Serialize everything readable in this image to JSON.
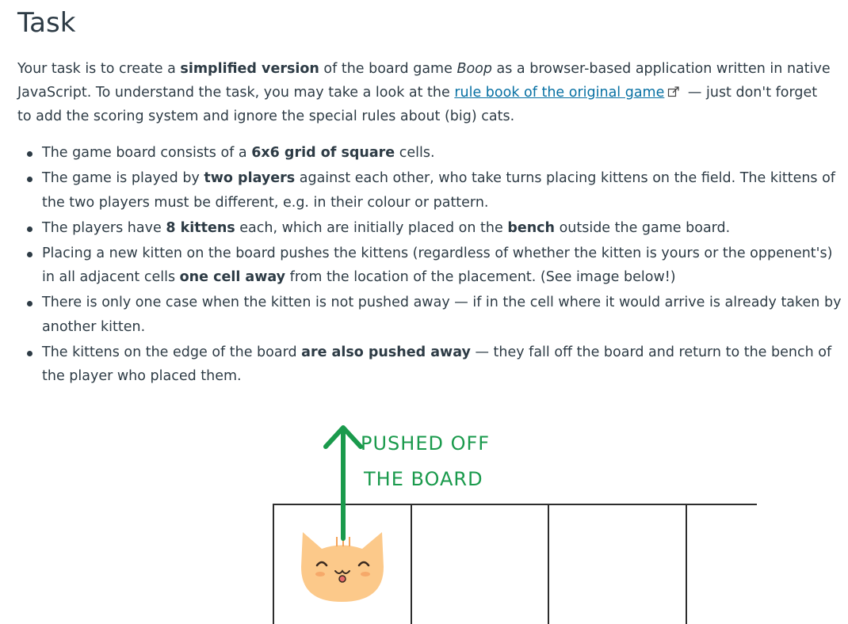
{
  "title": "Task",
  "intro": {
    "t1": "Your task is to create a ",
    "b1": "simplified version",
    "t2": " of the board game ",
    "i1": "Boop",
    "t3": " as a browser-based application written in native JavaScript. To understand the task, you may take a look at the ",
    "link": "rule book of the original game",
    "t4": " — just don't forget to add the scoring system and ignore the special rules about (big) cats."
  },
  "rules": [
    {
      "a": "The game board consists of a ",
      "b": "6x6 grid of square",
      "c": " cells."
    },
    {
      "a": "The game is played by ",
      "b": "two players",
      "c": " against each other, who take turns placing kittens on the field. The kittens of the two players must be different, e.g. in their colour or pattern."
    },
    {
      "a": "The players have ",
      "b": "8 kittens",
      "c": " each, which are initially placed on the ",
      "d": "bench",
      "e": " outside the game board."
    },
    {
      "a": "Placing a new kitten on the board pushes the kittens (regardless of whether the kitten is yours or the oppenent's) in all adjacent cells ",
      "b": "one cell away",
      "c": " from the location of the placement. (See image below!)"
    },
    {
      "a": "There is only one case when the kitten is not pushed away — if in the cell where it would arrive is already taken by another kitten."
    },
    {
      "a": "The kittens on the edge of the board ",
      "b": "are also pushed away",
      "c": " — they fall off the board and return to the bench of the player who placed them."
    }
  ],
  "figure": {
    "label_line1": "PUSHED OFF",
    "label_line2": "THE BOARD",
    "arrow_color": "#1a9a4c",
    "kitten_color": "#fcc98a"
  },
  "icons": {
    "external_link": "external-link-icon"
  }
}
